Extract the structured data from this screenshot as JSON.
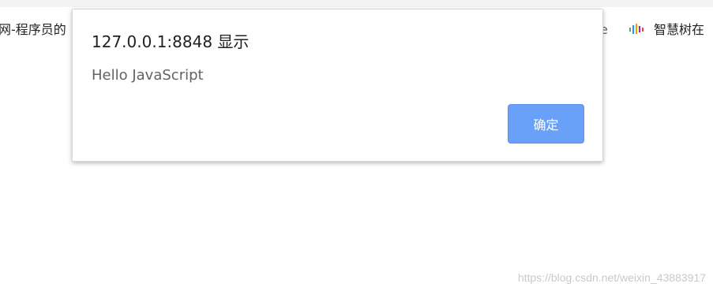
{
  "browser": {
    "bookmarks": {
      "left_item": "网-程序员的",
      "partial_item": "e",
      "right_item": "智慧树在"
    }
  },
  "dialog": {
    "title": "127.0.0.1:8848 显示",
    "message": "Hello JavaScript",
    "ok_label": "确定"
  },
  "watermark": "https://blog.csdn.net/weixin_43883917",
  "colors": {
    "ok_button": "#6aa1f8",
    "title_text": "#202124",
    "message_text": "#5f6368"
  },
  "icons": {
    "bookmark_favicon": "sound-bars-icon"
  }
}
